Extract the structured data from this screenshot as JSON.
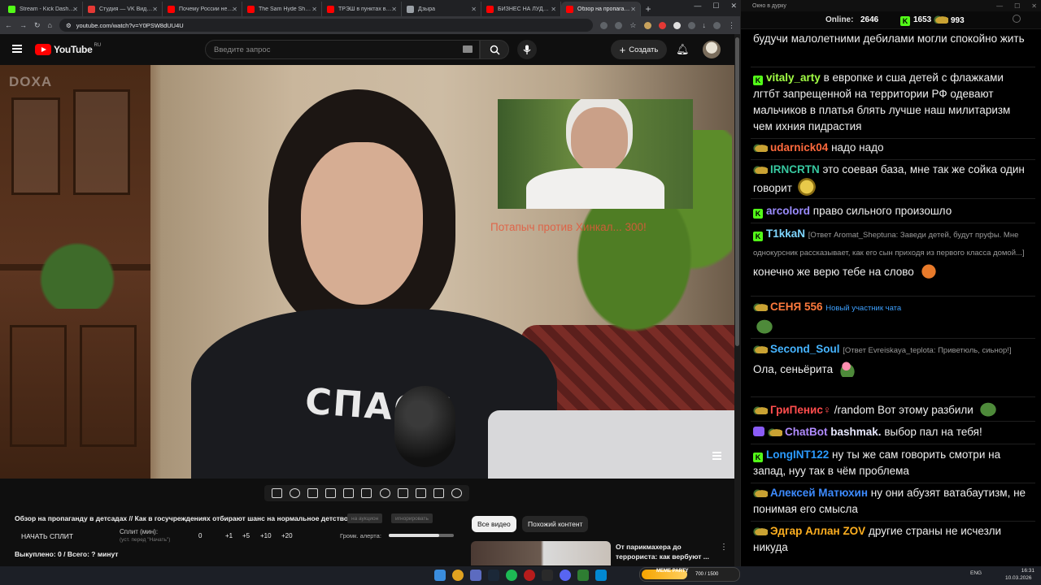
{
  "browser": {
    "tabs": [
      {
        "label": "Stream - Kick Dashboard",
        "color": "#53fc18"
      },
      {
        "label": "Студия — VK Видео Live",
        "color": "#e53935"
      },
      {
        "label": "Почему России не дают",
        "color": "#ff0000"
      },
      {
        "label": "The Sam Hyde Show D",
        "color": "#ff0000"
      },
      {
        "label": "ТРЭШ в пунктах выдачи",
        "color": "#ff0000"
      },
      {
        "label": "Дзыра",
        "color": "#9aa0a6"
      },
      {
        "label": "БИЗНЕС НА ЛУДОМАНИИ",
        "color": "#ff0000"
      },
      {
        "label": "Обзор на пропаганду в",
        "color": "#ff0000",
        "active": true
      }
    ],
    "url": "youtube.com/watch?v=Y0PSW8dUU4U",
    "window_controls": [
      "—",
      "☐",
      "✕"
    ]
  },
  "youtube": {
    "logo_text": "YouTube",
    "region": "RU",
    "search_placeholder": "Введите запрос",
    "create_label": "Создать"
  },
  "video": {
    "watermark": "DOXA",
    "inset_caption": "Потапыч против Хинкал... 300!",
    "shirt_text": "СПАСИ"
  },
  "extension": {
    "video_title": "Обзор на пропаганду в детсадах // Как в госучреждениях отбирают шанс на нормальное детство",
    "tag_auction": "на аукцион",
    "tag_ignore": "игнорировать",
    "split_button": "НАЧАТЬ СПЛИТ",
    "split_label": "Сплит (мин):",
    "split_hint": "(уст. перед \"Начать\")",
    "split_value": "0",
    "increments": [
      "+1",
      "+5",
      "+10",
      "+20"
    ],
    "alert_volume_label": "Громк. алерта:",
    "alert_volume": 0.78,
    "status": "Выкуплено: 0 / Всего: ? минут"
  },
  "recommendations": {
    "chips": [
      "Все видео",
      "Похожий контент"
    ],
    "first_title": "От парикмахера до террориста: как вербуют ..."
  },
  "chat": {
    "window_title": "Окно в дурку",
    "online_label": "Online:",
    "online_count": "2646",
    "kick_count": "1653",
    "other_count": "993",
    "messages": [
      {
        "user": "",
        "text": "будучи малолетними дебилами могли спокойно жить"
      },
      {
        "user": "vitaly_arty",
        "color": "#a2ff45",
        "badge": "k",
        "text": "в европке и сша детей с флажками лгтбт запрещенной на территории РФ одевают мальчиков в платья блять лучше наш милитаризм чем ихния пидрастия"
      },
      {
        "user": "udarnick04",
        "color": "#ff6a3d",
        "badge": "pepe",
        "text": "надо надо"
      },
      {
        "user": "IRNCRTN",
        "color": "#37c8a0",
        "badge": "pepe",
        "text": "это соевая база, мне так же сойка один говорит"
      },
      {
        "user": "arcolord",
        "color": "#9b8cff",
        "badge": "k",
        "text": "право сильного произошло"
      },
      {
        "user": "T1kkaN",
        "color": "#7fd6ff",
        "badge": "k",
        "reply": "[Ответ Aromat_Sheptuna: Заведи детей, будут пруфы. Мне однокурсник рассказывает, как его сын приходя из первого класса домой...]",
        "text": "конечно же верю тебе на слово"
      },
      {
        "user": "СЕНЯ 556",
        "color": "#ff7a3d",
        "badge": "pepe",
        "new_badge": "Новый участник чата",
        "text": ""
      },
      {
        "user": "Second_Soul",
        "color": "#46b4ff",
        "badge": "pepe",
        "reply": "[Ответ Evreiskaya_teplota: Приветюль, сиьнор!]",
        "text": "Ола, сеньёрита"
      },
      {
        "user": "ГриПенис♀",
        "color": "#ff4d4d",
        "badge": "pepe",
        "text": "/random Вот этому разбили"
      },
      {
        "user": "ChatBot",
        "color": "#b18cff",
        "badge": "bot",
        "mention": "bashmak.",
        "text": "выбор пал на тебя!"
      },
      {
        "user": "LongINT122",
        "color": "#2b9bff",
        "badge": "k",
        "text": "ну ты же сам говорить смотри на запад, нуу так в чём проблема"
      },
      {
        "user": "Алексей Матюхин",
        "color": "#3d8bff",
        "badge": "pepe",
        "text": "ну они абузят ватабаутизм, не понимая его смысла"
      },
      {
        "user": "Эдгар Аллан ZOV",
        "color": "#ffb020",
        "badge": "pepe",
        "text": "другие страны не исчезли никуда"
      }
    ]
  },
  "taskbar": {
    "meme_label": "MEME PARTY",
    "meme_count": "700 / 1500",
    "meme_progress": 0.47,
    "lang": "ENG",
    "time": "16:31",
    "date": "10.03.2026"
  }
}
